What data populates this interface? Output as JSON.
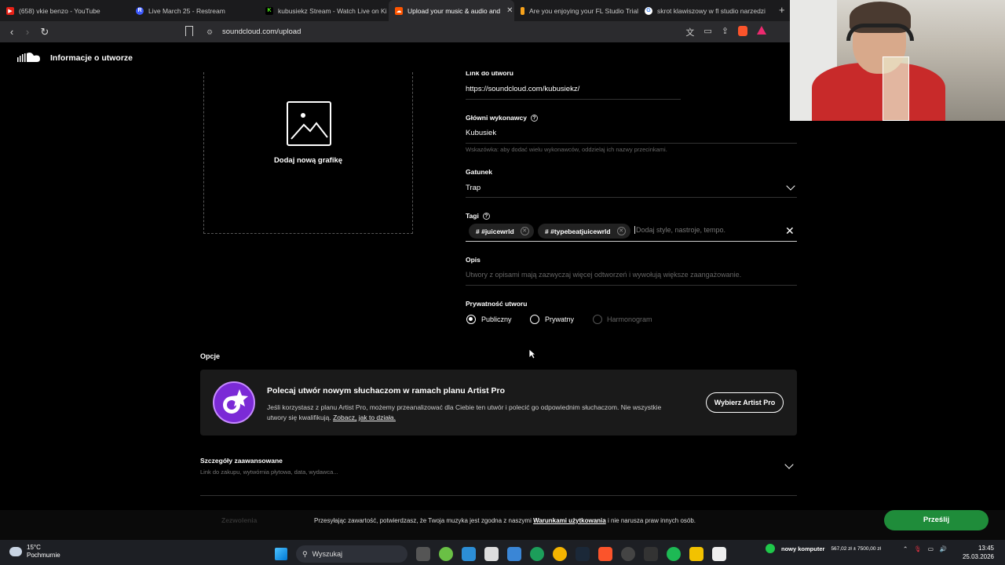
{
  "browser": {
    "tabs": [
      {
        "title": "(658) vkie benzo - YouTube",
        "fav_color": "#e62117",
        "fav_glyph": "▶"
      },
      {
        "title": "Live March 25 - Restream",
        "fav_color": "#3d5afe",
        "fav_glyph": "R"
      },
      {
        "title": "kubusiekz Stream - Watch Live on Ki",
        "fav_color": "#53fc18",
        "fav_glyph": "K"
      },
      {
        "title": "Upload your music & audio and",
        "fav_color": "#ff5500",
        "fav_glyph": "☁",
        "active": true
      },
      {
        "title": "Are you enjoying your FL Studio Trial",
        "fav_color": "#f7a21b",
        "fav_glyph": "▍"
      },
      {
        "title": "skrot klawiszowy w fl studio narzedzi",
        "fav_color": "#ffffff",
        "fav_glyph": "G"
      }
    ],
    "new_tab": "+",
    "url": "soundcloud.com/upload"
  },
  "header": {
    "title": "Informacje o utworze"
  },
  "artwork": {
    "label": "Dodaj nową grafikę"
  },
  "form": {
    "link_label": "Link do utworu",
    "link_value": "https://soundcloud.com/kubusiekz/",
    "artists_label": "Główni wykonawcy",
    "artists_value": "Kubusiek",
    "artists_hint": "Wskazówka: aby dodać wielu wykonawców, oddzielaj ich nazwy przecinkami.",
    "genre_label": "Gatunek",
    "genre_value": "Trap",
    "tags_label": "Tagi",
    "tags": [
      "# #juicewrld",
      "# #typebeatjuicewrld"
    ],
    "tags_placeholder": "Dodaj style, nastroje, tempo.",
    "description_label": "Opis",
    "description_placeholder": "Utwory z opisami mają zazwyczaj więcej odtworzeń i wywołują większe zaangażowanie.",
    "privacy_label": "Prywatność utworu",
    "privacy_options": [
      "Publiczny",
      "Prywatny",
      "Harmonogram"
    ],
    "privacy_selected": "Publiczny"
  },
  "options": {
    "heading": "Opcje",
    "promo_title": "Polecaj utwór nowym słuchaczom w ramach planu Artist Pro",
    "promo_text": "Jeśli korzystasz z planu Artist Pro, możemy przeanalizować dla Ciebie ten utwór i polecić go odpowiednim słuchaczom. Nie wszystkie utwory się kwalifikują.",
    "promo_link1": "Zobacz,",
    "promo_link2": "jak to działa.",
    "promo_button": "Wybierz Artist Pro"
  },
  "advanced": {
    "title": "Szczegóły zaawansowane",
    "subtitle": "Link do zakupu, wytwórnia płytowa, data, wydawca..."
  },
  "footer": {
    "text_before": "Przesyłając zawartość, potwierdzasz, że Twoja muzyka jest zgodna z naszymi",
    "terms_link": "Warunkami użytkowania",
    "text_after": "i nie narusza praw innych osób.",
    "submit": "Prześlij",
    "hidden_label": "Zezwolenia"
  },
  "taskbar": {
    "weather_temp": "15°C",
    "weather_desc": "Pochmurnie",
    "search": "Wyszukaj",
    "tray_label": "nowy komputer",
    "tray_values": "567,02 zł ± 7500,00 zł",
    "time": "13:45",
    "date": "25.03.2026"
  },
  "colors": {
    "accent_green": "#1f8c3a",
    "brand_orange": "#ff5500",
    "promo_purple": "#7b2ad6"
  }
}
